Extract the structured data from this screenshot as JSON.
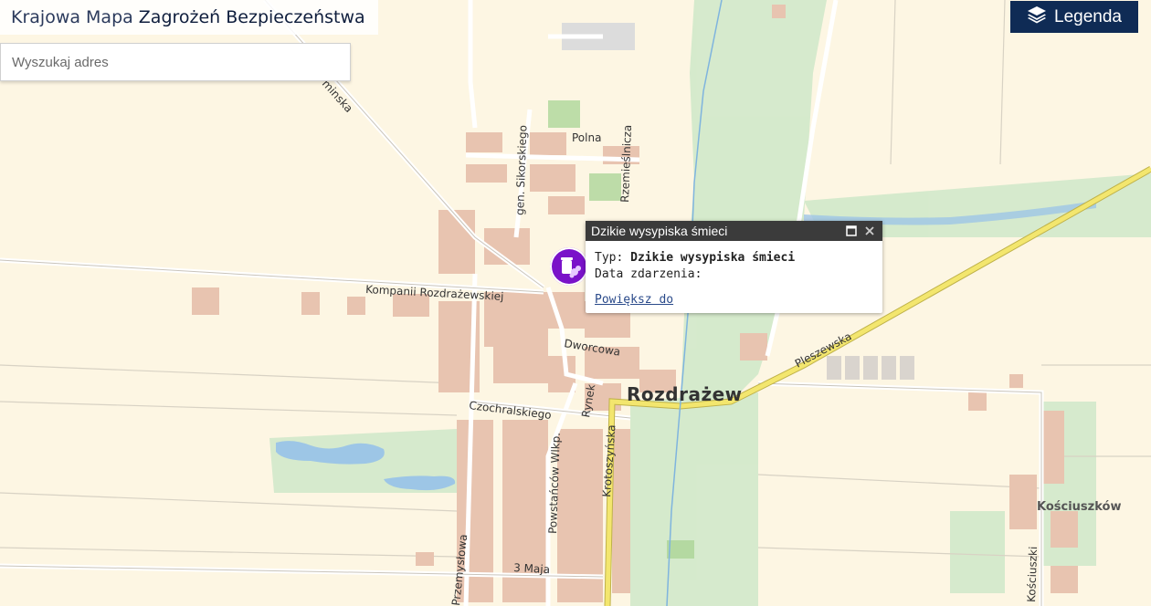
{
  "header": {
    "title_light": "Krajowa Mapa",
    "title_bold": "Zagrożeń Bezpieczeństwa"
  },
  "search": {
    "placeholder": "Wyszukaj adres",
    "value": ""
  },
  "legend": {
    "label": "Legenda",
    "icon": "layers-icon"
  },
  "map": {
    "town_label": "Rozdrażew",
    "village_label": "Kościuszków",
    "streets": {
      "kaminska": "minska",
      "polna": "Polna",
      "sikorskiego": "gen. Sikorskiego",
      "rzemieslnicza": "Rzemieślnicza",
      "kompanii": "Kompanii Rozdrażewskiej",
      "dworcowa": "Dworcowa",
      "rynek": "Rynek",
      "czochralskiego": "Czochralskiego",
      "krotoszynska": "Krotoszyńska",
      "powstancow": "Powstańców Wlkp.",
      "przemyslowa": "Przemysłowa",
      "trzecia_maja": "3 Maja",
      "pleszewska": "Pleszewska",
      "kosciuszki": "Kościuszki"
    },
    "colors": {
      "background": "#fdf6e3",
      "built_up": "#e8c4b0",
      "forest": "#c8e6c4",
      "water": "#a9cce8",
      "main_road": "#f0e070",
      "marker": "#7a12c9"
    }
  },
  "marker": {
    "icon": "waste-dump-icon"
  },
  "popup": {
    "title": "Dzikie wysypiska śmieci",
    "type_label": "Typ:",
    "type_value": "Dzikie wysypiska śmieci",
    "date_label": "Data zdarzenia:",
    "zoom_link": "Powiększ do"
  }
}
